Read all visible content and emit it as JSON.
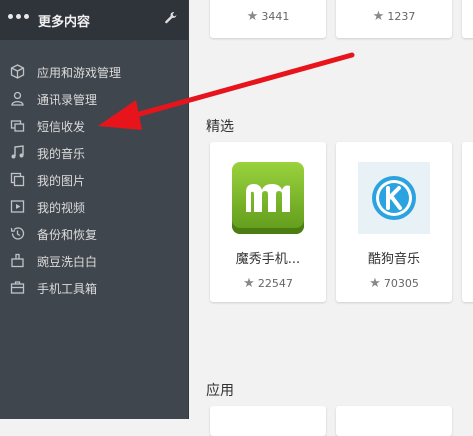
{
  "sidebar": {
    "title": "更多内容",
    "items": [
      {
        "label": "应用和游戏管理",
        "icon": "cube-icon"
      },
      {
        "label": "通讯录管理",
        "icon": "person-icon"
      },
      {
        "label": "短信收发",
        "icon": "message-icon"
      },
      {
        "label": "我的音乐",
        "icon": "music-icon"
      },
      {
        "label": "我的图片",
        "icon": "image-icon"
      },
      {
        "label": "我的视频",
        "icon": "video-icon"
      },
      {
        "label": "备份和恢复",
        "icon": "history-icon"
      },
      {
        "label": "豌豆洗白白",
        "icon": "clean-icon"
      },
      {
        "label": "手机工具箱",
        "icon": "toolbox-icon"
      }
    ]
  },
  "main": {
    "top_cards": [
      {
        "rating": "3441"
      },
      {
        "rating": "1237"
      }
    ],
    "featured_title": "精选",
    "featured": [
      {
        "name": "魔秀手机...",
        "rating": "22547"
      },
      {
        "name": "酷狗音乐",
        "rating": "70305"
      }
    ],
    "apps_title": "应用"
  },
  "colors": {
    "sidebar_bg": "#40464d",
    "header_bg": "#2f343a",
    "arrow": "#e8141c"
  }
}
